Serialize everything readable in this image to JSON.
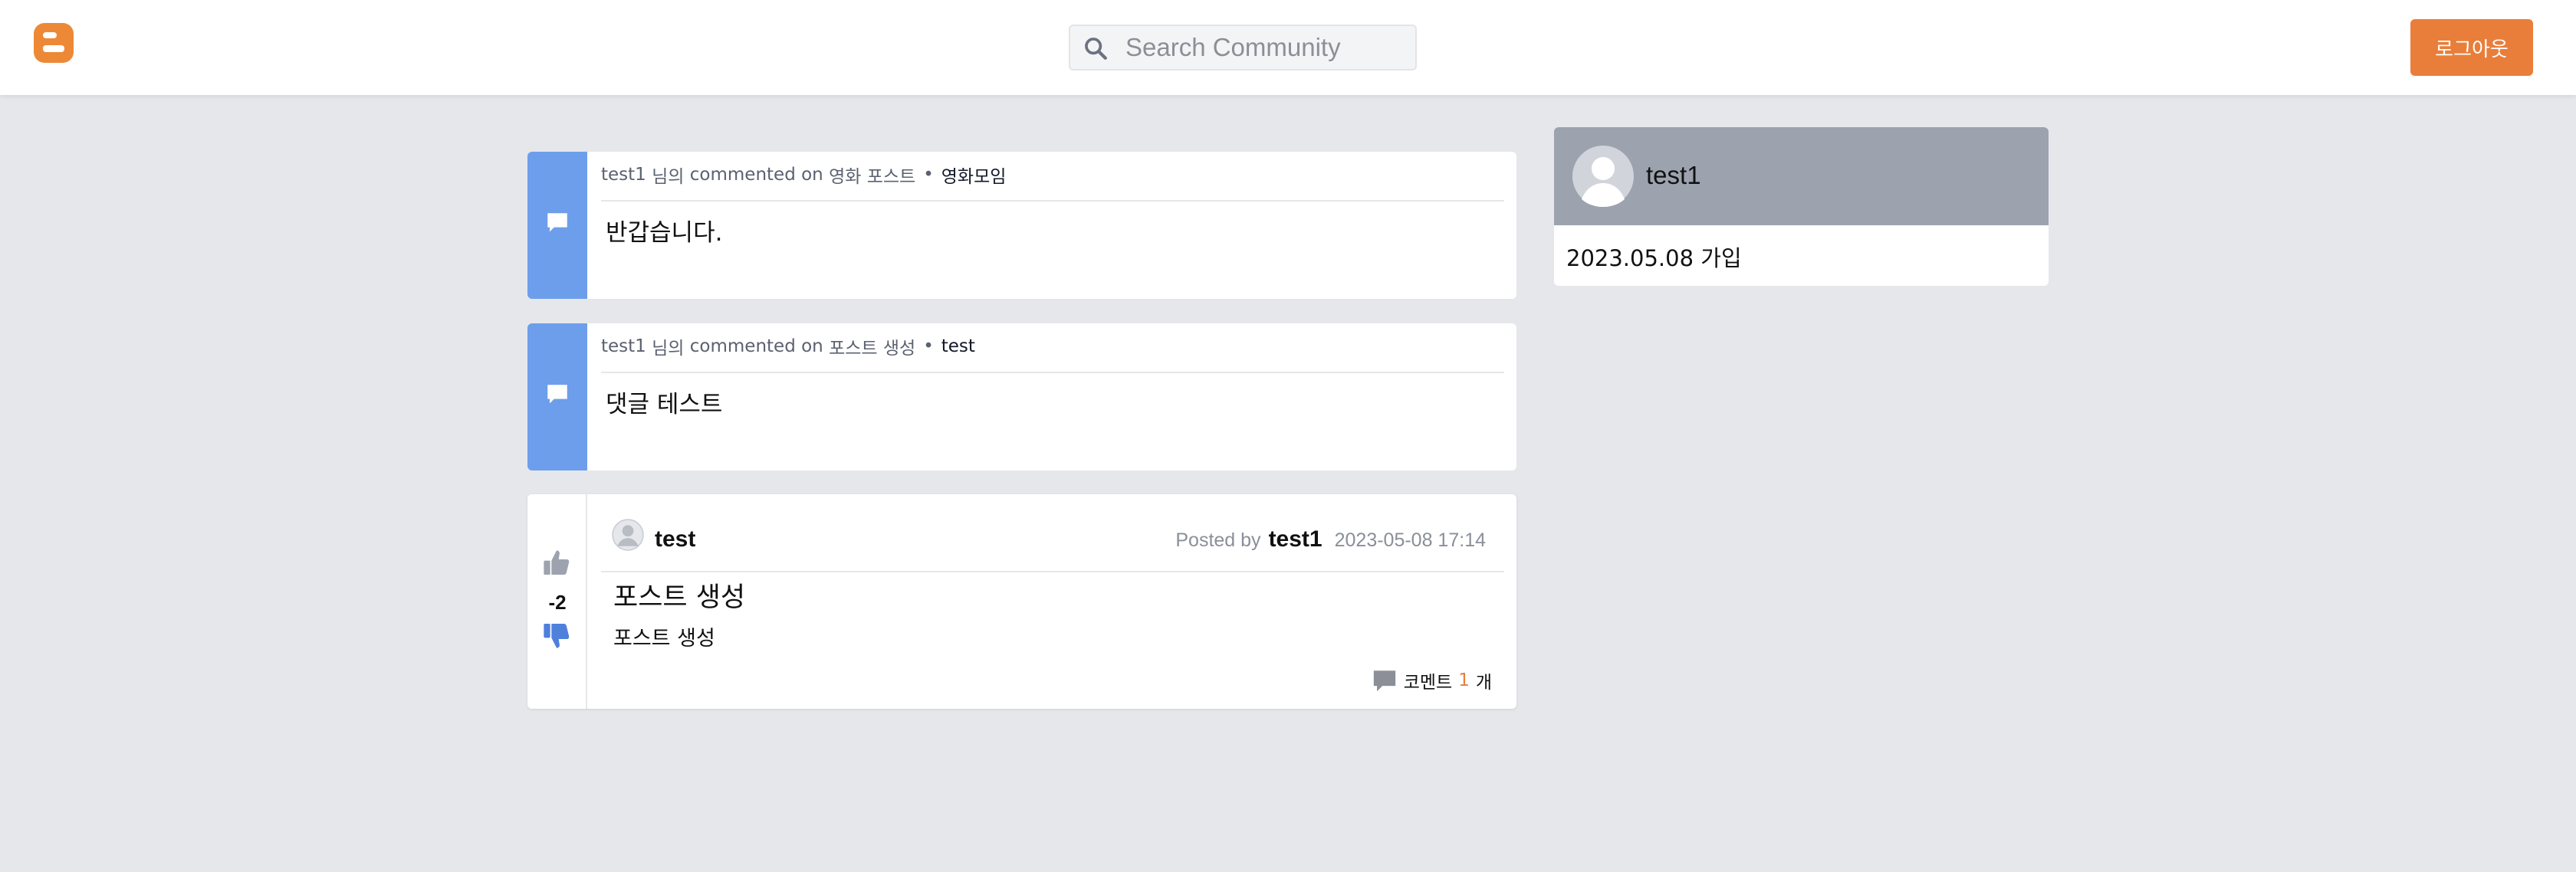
{
  "header": {
    "search_placeholder": "Search Community",
    "logout_label": "로그아웃"
  },
  "comments": [
    {
      "user": "test1",
      "suffix": "님의",
      "action": "commented on",
      "post": "영화 포스트",
      "community": "영화모임",
      "body": "반갑습니다."
    },
    {
      "user": "test1",
      "suffix": "님의",
      "action": "commented on",
      "post": "포스트 생성",
      "community": "test",
      "body": "댓글 테스트"
    }
  ],
  "post": {
    "vote_count": "-2",
    "community": "test",
    "posted_by_label": "Posted by",
    "author": "test1",
    "date": "2023-05-08 17:14",
    "title": "포스트 생성",
    "body": "포스트 생성",
    "comments_label": "코멘트",
    "comments_count": "1",
    "comments_unit": "개"
  },
  "profile": {
    "username": "test1",
    "joined": "2023.05.08 가입"
  },
  "colors": {
    "accent_orange": "#e97e3a",
    "comment_blue": "#6d9eeb",
    "profile_gray": "#9ca3af",
    "page_bg": "#e5e7eb"
  },
  "icons": {
    "logo": "blogger-logo-icon",
    "search": "search-icon",
    "comment": "comment-bubble-icon",
    "upvote": "thumbs-up-icon",
    "downvote": "thumbs-down-icon",
    "avatar": "user-avatar-icon"
  }
}
